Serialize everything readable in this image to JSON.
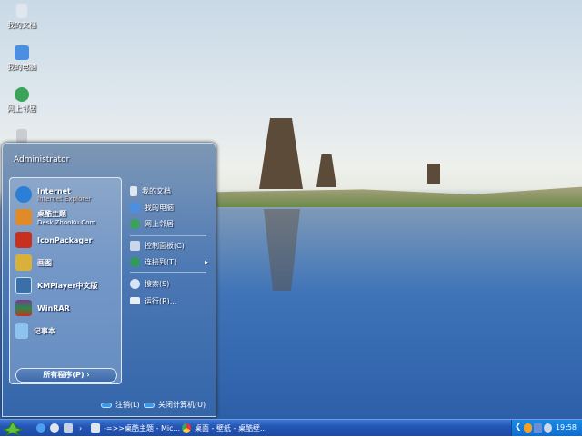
{
  "desktop": {
    "icons": [
      {
        "label": "我的文档",
        "icon": "my-documents-icon"
      },
      {
        "label": "我的电脑",
        "icon": "my-computer-icon"
      },
      {
        "label": "网上邻居",
        "icon": "network-icon"
      },
      {
        "label": "",
        "icon": "recycle-bin-icon"
      }
    ]
  },
  "start_menu": {
    "user": "Administrator",
    "left_items": [
      {
        "label": "Internet",
        "sub": "Internet Explorer",
        "icon": "ie-icon",
        "color": "#2b7fd6"
      },
      {
        "label": "桌酷主题",
        "sub": "Desk.ZhooKu.Com",
        "icon": "zhooku-icon",
        "color": "#e08a2a"
      },
      {
        "label": "IconPackager",
        "icon": "iconpackager-icon",
        "color": "#c8301e"
      },
      {
        "label": "画图",
        "icon": "paint-icon",
        "color": "#d9b13a"
      },
      {
        "label": "KMPlayer中文版",
        "icon": "kmplayer-icon",
        "color": "#3b6fa8"
      },
      {
        "label": "WinRAR",
        "icon": "winrar-icon",
        "color": "#7a3b8c"
      },
      {
        "label": "记事本",
        "icon": "notepad-icon",
        "color": "#8cc4ee"
      }
    ],
    "all_programs": "所有程序(P)",
    "right_items": [
      {
        "label": "我的文档",
        "icon": "my-documents-icon"
      },
      {
        "label": "我的电脑",
        "icon": "my-computer-icon"
      },
      {
        "label": "网上邻居",
        "icon": "network-icon"
      },
      {
        "label": "控制面板(C)",
        "icon": "control-panel-icon"
      },
      {
        "label": "连接到(T)",
        "icon": "connect-icon",
        "arrow": "▸"
      },
      {
        "label": "搜索(S)",
        "icon": "search-icon"
      },
      {
        "label": "运行(R)...",
        "icon": "run-icon"
      }
    ],
    "logoff": "注销(L)",
    "shutdown": "关闭计算机(U)"
  },
  "taskbar": {
    "quick_launch": [
      "ie-icon",
      "browser-icon",
      "desktop-icon"
    ],
    "chevron": "›",
    "tasks": [
      {
        "label": "-=>>桌酷主题 - Mic...",
        "icon": "word-icon"
      },
      {
        "label": "桌面 - 壁纸 - 桌酷壁...",
        "icon": "chrome-icon"
      }
    ],
    "tray_icons": [
      "show-hidden-icon",
      "qq-icon",
      "network-tray-icon",
      "ime-icon"
    ],
    "clock": "19:58"
  }
}
